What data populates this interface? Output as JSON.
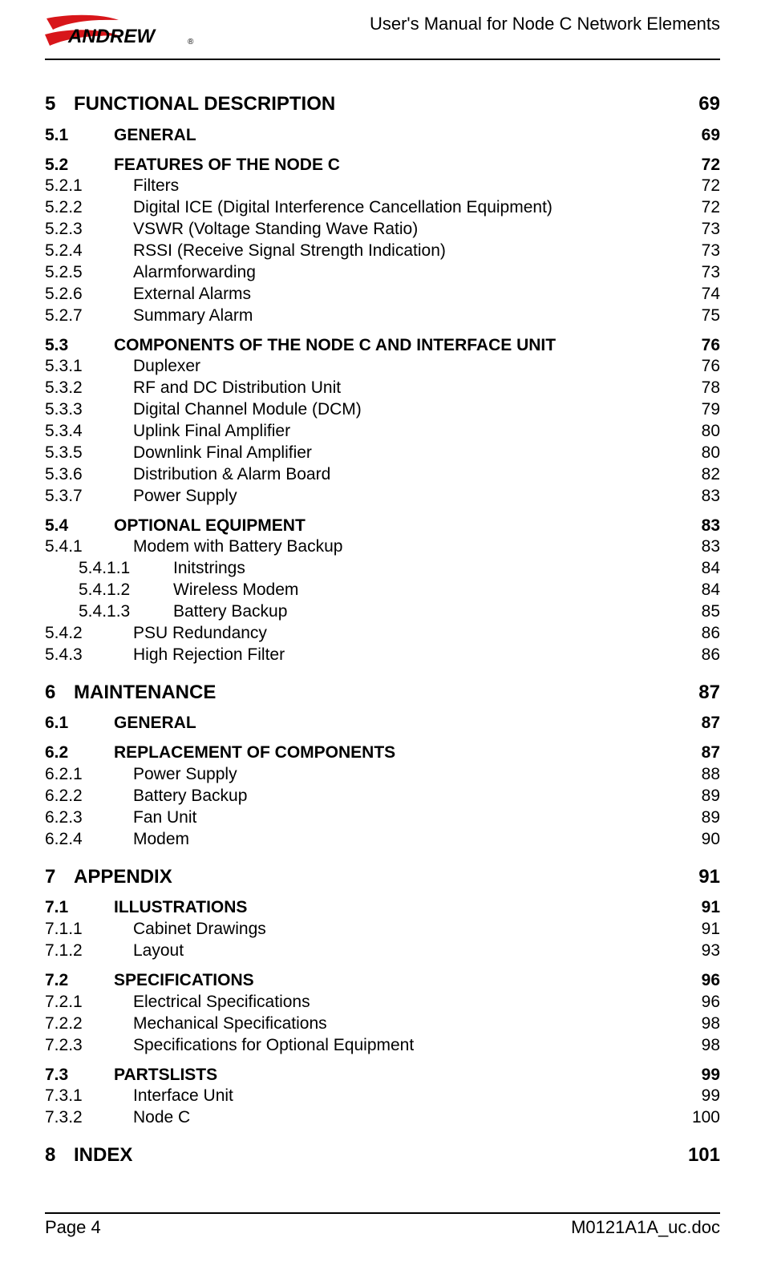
{
  "header": {
    "doc_title": "User's Manual for Node C Network Elements",
    "logo_brand": "ANDREW",
    "logo_tm": "®"
  },
  "toc": [
    {
      "level": "h1",
      "num": "5",
      "title": "FUNCTIONAL DESCRIPTION",
      "page": "69",
      "space_before": "none"
    },
    {
      "level": "h2",
      "num": "5.1",
      "title": "GENERAL",
      "page": "69",
      "space_before": "sm"
    },
    {
      "level": "h2",
      "num": "5.2",
      "title": "FEATURES OF THE NODE C",
      "page": "72",
      "space_before": "sm"
    },
    {
      "level": "h3",
      "num": "5.2.1",
      "title": "Filters",
      "page": "72"
    },
    {
      "level": "h3",
      "num": "5.2.2",
      "title": "Digital ICE (Digital Interference Cancellation Equipment)",
      "page": "72"
    },
    {
      "level": "h3",
      "num": "5.2.3",
      "title": "VSWR (Voltage Standing Wave Ratio)",
      "page": "73"
    },
    {
      "level": "h3",
      "num": "5.2.4",
      "title": "RSSI (Receive Signal Strength Indication)",
      "page": "73"
    },
    {
      "level": "h3",
      "num": "5.2.5",
      "title": "Alarmforwarding",
      "page": "73"
    },
    {
      "level": "h3",
      "num": "5.2.6",
      "title": "External Alarms",
      "page": "74"
    },
    {
      "level": "h3",
      "num": "5.2.7",
      "title": "Summary Alarm",
      "page": "75"
    },
    {
      "level": "h2",
      "num": "5.3",
      "title": "COMPONENTS OF THE NODE C AND INTERFACE UNIT",
      "page": "76",
      "space_before": "sm"
    },
    {
      "level": "h3",
      "num": "5.3.1",
      "title": "Duplexer",
      "page": "76"
    },
    {
      "level": "h3",
      "num": "5.3.2",
      "title": "RF and DC Distribution Unit",
      "page": "78"
    },
    {
      "level": "h3",
      "num": "5.3.3",
      "title": "Digital Channel Module (DCM)",
      "page": "79"
    },
    {
      "level": "h3",
      "num": "5.3.4",
      "title": "Uplink Final Amplifier",
      "page": "80"
    },
    {
      "level": "h3",
      "num": "5.3.5",
      "title": "Downlink Final Amplifier",
      "page": "80"
    },
    {
      "level": "h3",
      "num": "5.3.6",
      "title": "Distribution & Alarm Board",
      "page": "82"
    },
    {
      "level": "h3",
      "num": "5.3.7",
      "title": "Power Supply",
      "page": "83"
    },
    {
      "level": "h2",
      "num": "5.4",
      "title": "OPTIONAL EQUIPMENT",
      "page": "83",
      "space_before": "sm"
    },
    {
      "level": "h3",
      "num": "5.4.1",
      "title": "Modem with Battery Backup",
      "page": "83"
    },
    {
      "level": "h4",
      "num": "5.4.1.1",
      "title": "Initstrings",
      "page": "84"
    },
    {
      "level": "h4",
      "num": "5.4.1.2",
      "title": "Wireless Modem",
      "page": "84"
    },
    {
      "level": "h4",
      "num": "5.4.1.3",
      "title": "Battery Backup",
      "page": "85"
    },
    {
      "level": "h3",
      "num": "5.4.2",
      "title": "PSU Redundancy",
      "page": "86"
    },
    {
      "level": "h3",
      "num": "5.4.3",
      "title": "High Rejection Filter",
      "page": "86"
    },
    {
      "level": "h1",
      "num": "6",
      "title": "MAINTENANCE",
      "page": "87",
      "space_before": "lg"
    },
    {
      "level": "h2",
      "num": "6.1",
      "title": "GENERAL",
      "page": "87",
      "space_before": "sm"
    },
    {
      "level": "h2",
      "num": "6.2",
      "title": "REPLACEMENT OF COMPONENTS",
      "page": "87",
      "space_before": "sm"
    },
    {
      "level": "h3",
      "num": "6.2.1",
      "title": "Power Supply",
      "page": "88"
    },
    {
      "level": "h3",
      "num": "6.2.2",
      "title": "Battery Backup",
      "page": "89"
    },
    {
      "level": "h3",
      "num": "6.2.3",
      "title": "Fan Unit",
      "page": "89"
    },
    {
      "level": "h3",
      "num": "6.2.4",
      "title": "Modem",
      "page": "90"
    },
    {
      "level": "h1",
      "num": "7",
      "title": "APPENDIX",
      "page": "91",
      "space_before": "lg"
    },
    {
      "level": "h2",
      "num": "7.1",
      "title": "ILLUSTRATIONS",
      "page": "91",
      "space_before": "sm"
    },
    {
      "level": "h3",
      "num": "7.1.1",
      "title": "Cabinet Drawings",
      "page": "91"
    },
    {
      "level": "h3",
      "num": "7.1.2",
      "title": "Layout",
      "page": "93"
    },
    {
      "level": "h2",
      "num": "7.2",
      "title": "SPECIFICATIONS",
      "page": "96",
      "space_before": "sm"
    },
    {
      "level": "h3",
      "num": "7.2.1",
      "title": "Electrical Specifications",
      "page": "96"
    },
    {
      "level": "h3",
      "num": "7.2.2",
      "title": "Mechanical Specifications",
      "page": "98"
    },
    {
      "level": "h3",
      "num": "7.2.3",
      "title": "Specifications for Optional Equipment",
      "page": "98"
    },
    {
      "level": "h2",
      "num": "7.3",
      "title": "PARTSLISTS",
      "page": "99",
      "space_before": "sm"
    },
    {
      "level": "h3",
      "num": "7.3.1",
      "title": "Interface Unit",
      "page": "99"
    },
    {
      "level": "h3",
      "num": "7.3.2",
      "title": "Node C",
      "page": "100"
    },
    {
      "level": "h1",
      "num": "8",
      "title": "INDEX",
      "page": "101",
      "space_before": "lg"
    }
  ],
  "footer": {
    "page_label": "Page 4",
    "doc_filename": "M0121A1A_uc.doc"
  }
}
